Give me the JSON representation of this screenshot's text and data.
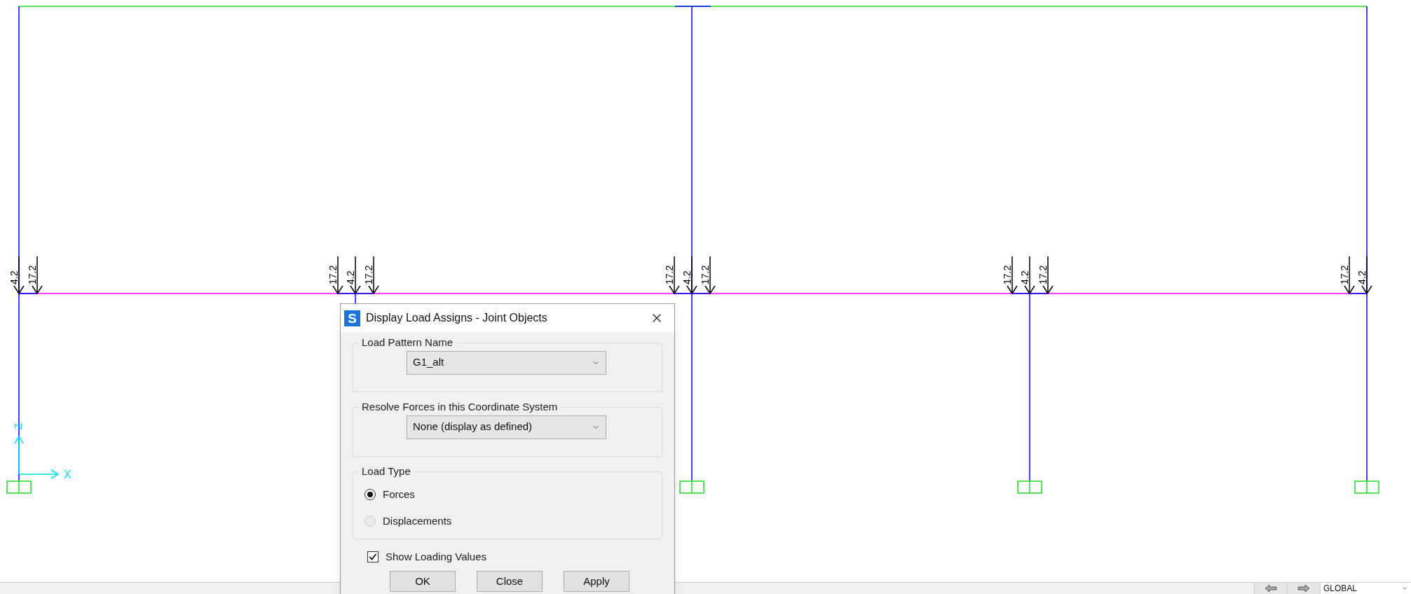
{
  "canvas": {
    "joints": [
      {
        "joint_load": "4.2",
        "right_load": "17.2"
      },
      {
        "left_load": "17.2",
        "joint_load": "4.2",
        "right_load": "17.2"
      },
      {
        "left_load": "17.2",
        "joint_load": "4.2",
        "right_load": "17.2"
      },
      {
        "left_load": "17.2",
        "joint_load": "4.2",
        "right_load": "17.2"
      },
      {
        "left_load": "17.2",
        "joint_load": "4.2"
      }
    ],
    "axes": {
      "z_label": "Z",
      "x_label": "X"
    }
  },
  "dialog": {
    "app_letter": "S",
    "title": "Display Load Assigns - Joint Objects",
    "load_pattern": {
      "label": "Load Pattern Name",
      "value": "G1_alt"
    },
    "coordinate_system": {
      "label": "Resolve Forces in this Coordinate System",
      "value": "None (display as defined)"
    },
    "load_type": {
      "label": "Load Type",
      "options": [
        {
          "label": "Forces",
          "selected": true,
          "disabled": false
        },
        {
          "label": "Displacements",
          "selected": false,
          "disabled": true
        }
      ]
    },
    "show_values": {
      "label": "Show Loading Values",
      "checked": true
    },
    "buttons": [
      "OK",
      "Close",
      "Apply"
    ]
  },
  "status_bar": {
    "coordinate_system": "GLOBAL"
  }
}
